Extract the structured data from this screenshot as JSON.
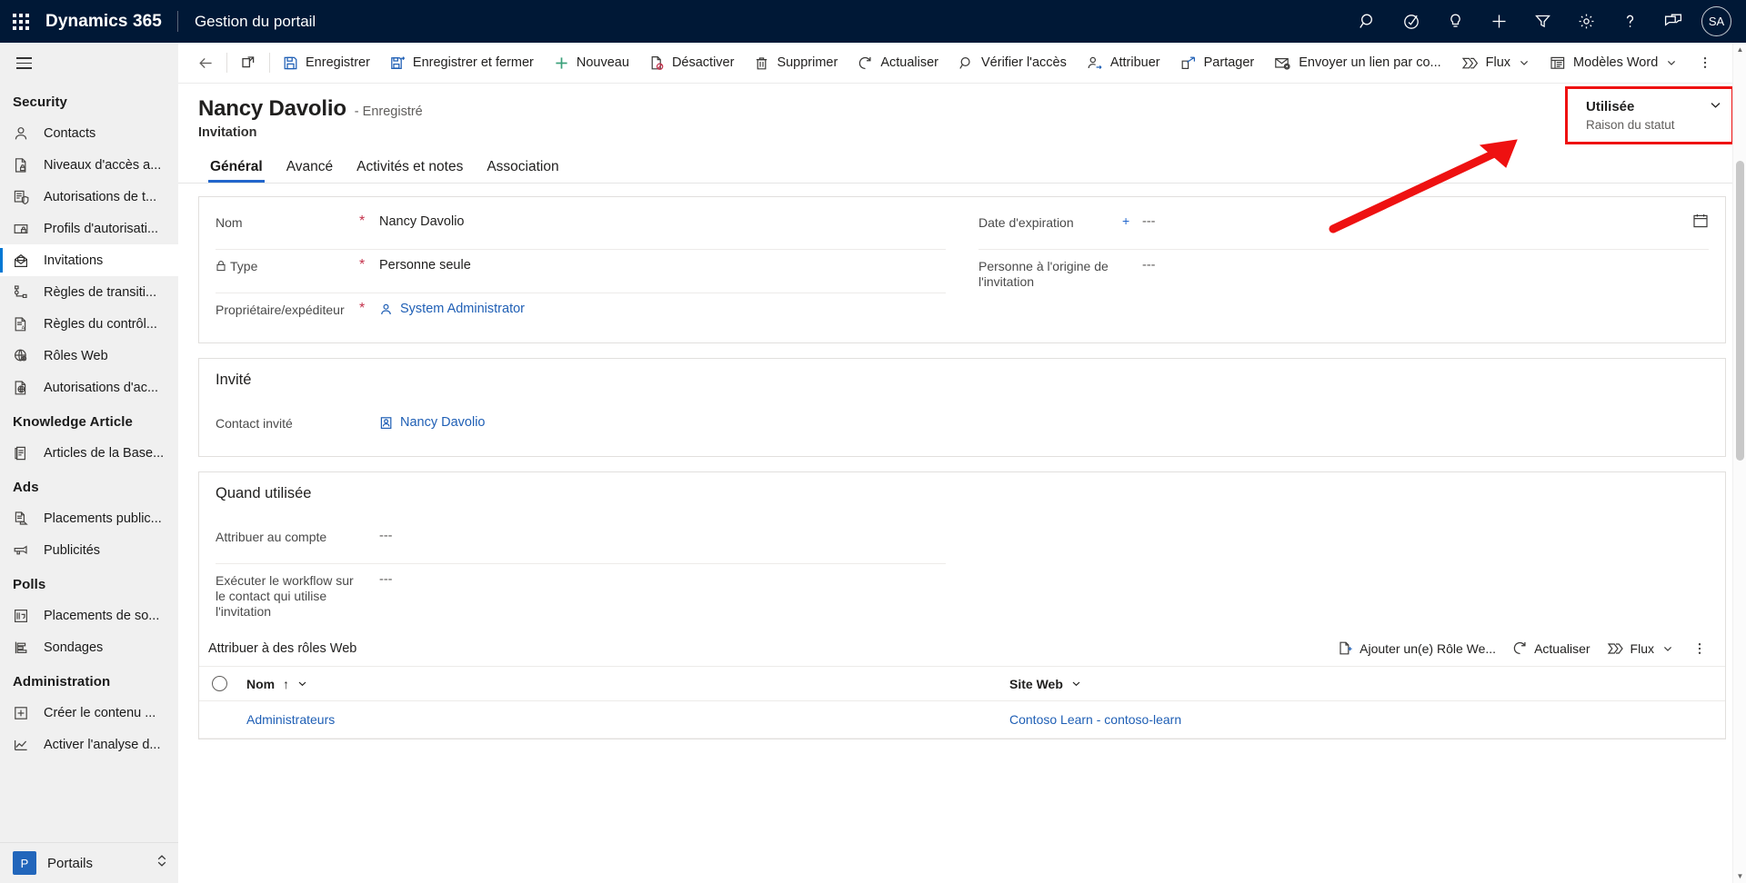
{
  "appbar": {
    "waffle_icon": "waffle-grid-icon",
    "brand": "Dynamics 365",
    "app_name": "Gestion du portail",
    "icons": [
      {
        "name": "search-icon",
        "label": "Recherche"
      },
      {
        "name": "assistant-icon",
        "label": "Assistant de pertinence"
      },
      {
        "name": "lightbulb-icon",
        "label": "Informations"
      },
      {
        "name": "plus-icon",
        "label": "Nouveau"
      },
      {
        "name": "filter-icon",
        "label": "Filtre"
      },
      {
        "name": "gear-icon",
        "label": "Paramètres"
      },
      {
        "name": "help-icon",
        "label": "Aide"
      },
      {
        "name": "feedback-icon",
        "label": "Commentaires"
      }
    ],
    "avatar_initials": "SA",
    "avatar_color": "#001836"
  },
  "sidebar": {
    "hamburger_icon": "hamburger-icon",
    "groups": [
      {
        "title": "Security",
        "items": [
          {
            "label": "Contacts",
            "icon": "person-icon",
            "selected": false
          },
          {
            "label": "Niveaux d'accès a...",
            "icon": "page-lock-icon",
            "selected": false
          },
          {
            "label": "Autorisations de t...",
            "icon": "list-shield-icon",
            "selected": false
          },
          {
            "label": "Profils d'autorisati...",
            "icon": "card-lock-icon",
            "selected": false
          },
          {
            "label": "Invitations",
            "icon": "envelope-open-icon",
            "selected": true
          },
          {
            "label": "Règles de transiti...",
            "icon": "node-tree-icon",
            "selected": false
          },
          {
            "label": "Règles du contrôl...",
            "icon": "page-rules-icon",
            "selected": false
          },
          {
            "label": "Rôles Web",
            "icon": "globe-person-icon",
            "selected": false
          },
          {
            "label": "Autorisations d'ac...",
            "icon": "page-globe-icon",
            "selected": false
          }
        ]
      },
      {
        "title": "Knowledge Article",
        "items": [
          {
            "label": "Articles de la Base...",
            "icon": "book-page-icon",
            "selected": false
          }
        ]
      },
      {
        "title": "Ads",
        "items": [
          {
            "label": "Placements public...",
            "icon": "ad-placement-icon",
            "selected": false
          },
          {
            "label": "Publicités",
            "icon": "megaphone-icon",
            "selected": false
          }
        ]
      },
      {
        "title": "Polls",
        "items": [
          {
            "label": "Placements de so...",
            "icon": "poll-placement-icon",
            "selected": false
          },
          {
            "label": "Sondages",
            "icon": "poll-bars-icon",
            "selected": false
          }
        ]
      },
      {
        "title": "Administration",
        "items": [
          {
            "label": "Créer le contenu ...",
            "icon": "plus-box-icon",
            "selected": false
          },
          {
            "label": "Activer l'analyse d...",
            "icon": "chart-line-icon",
            "selected": false
          }
        ]
      }
    ],
    "footer": {
      "tile_letter": "P",
      "label": "Portails",
      "chevron_icon": "chevron-updown-icon"
    }
  },
  "commandbar": {
    "back_icon": "back-arrow-icon",
    "popout_icon": "open-in-new-icon",
    "buttons": [
      {
        "label": "Enregistrer",
        "icon": "save-icon"
      },
      {
        "label": "Enregistrer et fermer",
        "icon": "save-close-icon"
      },
      {
        "label": "Nouveau",
        "icon": "plus-icon"
      },
      {
        "label": "Désactiver",
        "icon": "deactivate-icon"
      },
      {
        "label": "Supprimer",
        "icon": "trash-icon"
      },
      {
        "label": "Actualiser",
        "icon": "refresh-icon"
      },
      {
        "label": "Vérifier l'accès",
        "icon": "check-access-icon"
      },
      {
        "label": "Attribuer",
        "icon": "assign-person-icon"
      },
      {
        "label": "Partager",
        "icon": "share-icon"
      },
      {
        "label": "Envoyer un lien par co...",
        "icon": "send-mail-link-icon"
      },
      {
        "label": "Flux",
        "icon": "flow-icon",
        "caret": true
      },
      {
        "label": "Modèles Word",
        "icon": "word-template-icon",
        "caret": true
      }
    ],
    "overflow_icon": "more-vertical-icon"
  },
  "record": {
    "title": "Nancy Davolio",
    "state": "- Enregistré",
    "entity": "Invitation",
    "status": {
      "value": "Utilisée",
      "label": "Raison du statut",
      "chevron_icon": "chevron-down-icon",
      "highlight_color": "#ee1111"
    }
  },
  "tabs": [
    {
      "label": "Général",
      "active": true
    },
    {
      "label": "Avancé",
      "active": false
    },
    {
      "label": "Activités et notes",
      "active": false
    },
    {
      "label": "Association",
      "active": false
    }
  ],
  "general": {
    "left_fields": [
      {
        "label": "Nom",
        "required_marker": "*",
        "marker_kind": "required",
        "value": "Nancy Davolio",
        "kind": "text",
        "locked": false
      },
      {
        "label": "Type",
        "required_marker": "*",
        "marker_kind": "required",
        "value": "Personne seule",
        "kind": "text",
        "locked": true,
        "lock_icon": "lock-icon"
      },
      {
        "label": "Propriétaire/expéditeur",
        "required_marker": "*",
        "marker_kind": "required",
        "value": "System Administrator",
        "kind": "lookup",
        "lookup_icon": "person-icon",
        "locked": false
      }
    ],
    "right_fields": [
      {
        "label": "Date d'expiration",
        "required_marker": "+",
        "marker_kind": "recommended",
        "value": "---",
        "kind": "date",
        "calendar_icon": "calendar-icon"
      },
      {
        "label": "Personne à l'origine de l'invitation",
        "required_marker": "",
        "marker_kind": "none",
        "value": "---",
        "kind": "text"
      }
    ]
  },
  "invite_section": {
    "title": "Invité",
    "fields": [
      {
        "label": "Contact invité",
        "value": "Nancy Davolio",
        "kind": "lookup",
        "lookup_icon": "contact-card-icon"
      }
    ]
  },
  "when_used_section": {
    "title": "Quand utilisée",
    "fields": [
      {
        "label": "Attribuer au compte",
        "value": "---"
      },
      {
        "label": "Exécuter le workflow sur le contact qui utilise l'invitation",
        "value": "---"
      }
    ]
  },
  "webroles_subgrid": {
    "title": "Attribuer à des rôles Web",
    "tools": [
      {
        "label": "Ajouter un(e) Rôle We...",
        "icon": "add-existing-icon"
      },
      {
        "label": "Actualiser",
        "icon": "refresh-icon"
      },
      {
        "label": "Flux",
        "icon": "flow-icon",
        "caret": true
      }
    ],
    "overflow_icon": "more-vertical-icon",
    "columns": [
      {
        "label": "Nom",
        "sort": "↑",
        "chevron_icon": "chevron-down-icon"
      },
      {
        "label": "Site Web",
        "sort": "",
        "chevron_icon": "chevron-down-icon"
      }
    ],
    "select_all_icon": "select-circle-icon",
    "rows": [
      {
        "select_icon": "select-circle-icon",
        "name": "Administrateurs",
        "website": "Contoso Learn - contoso-learn"
      }
    ]
  },
  "scrollbar": {
    "up_icon": "chevron-up-icon",
    "down_icon": "chevron-down-icon",
    "thumb_name": "scroll-thumb"
  }
}
